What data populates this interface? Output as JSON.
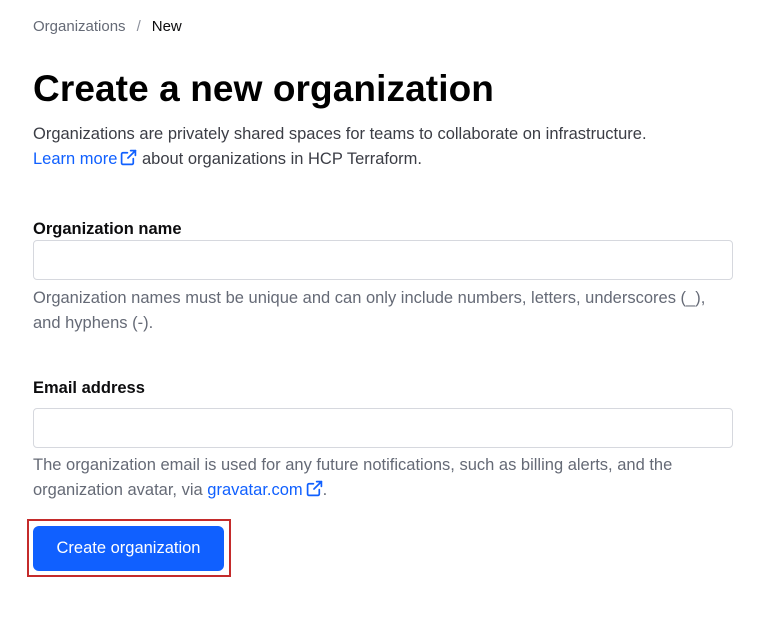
{
  "breadcrumb": {
    "parent": "Organizations",
    "separator": "/",
    "current": "New"
  },
  "page": {
    "title": "Create a new organization",
    "intro_text": "Organizations are privately shared spaces for teams to collaborate on infrastructure.",
    "learn_more_link": "Learn more",
    "learn_more_suffix": " about organizations in HCP Terraform."
  },
  "form": {
    "org_name": {
      "label": "Organization name",
      "value": "",
      "help": "Organization names must be unique and can only include numbers, letters, underscores (_), and hyphens (-)."
    },
    "email": {
      "label": "Email address",
      "value": "",
      "help_prefix": "The organization email is used for any future notifications, such as billing alerts, and the organization avatar, via ",
      "help_link": "gravatar.com",
      "help_suffix": "."
    },
    "submit_label": "Create organization"
  },
  "icons": {
    "external_link": "external-link-icon"
  },
  "colors": {
    "link": "#1060ff",
    "primary_button": "#1060ff",
    "highlight_border": "#c42b2b"
  }
}
